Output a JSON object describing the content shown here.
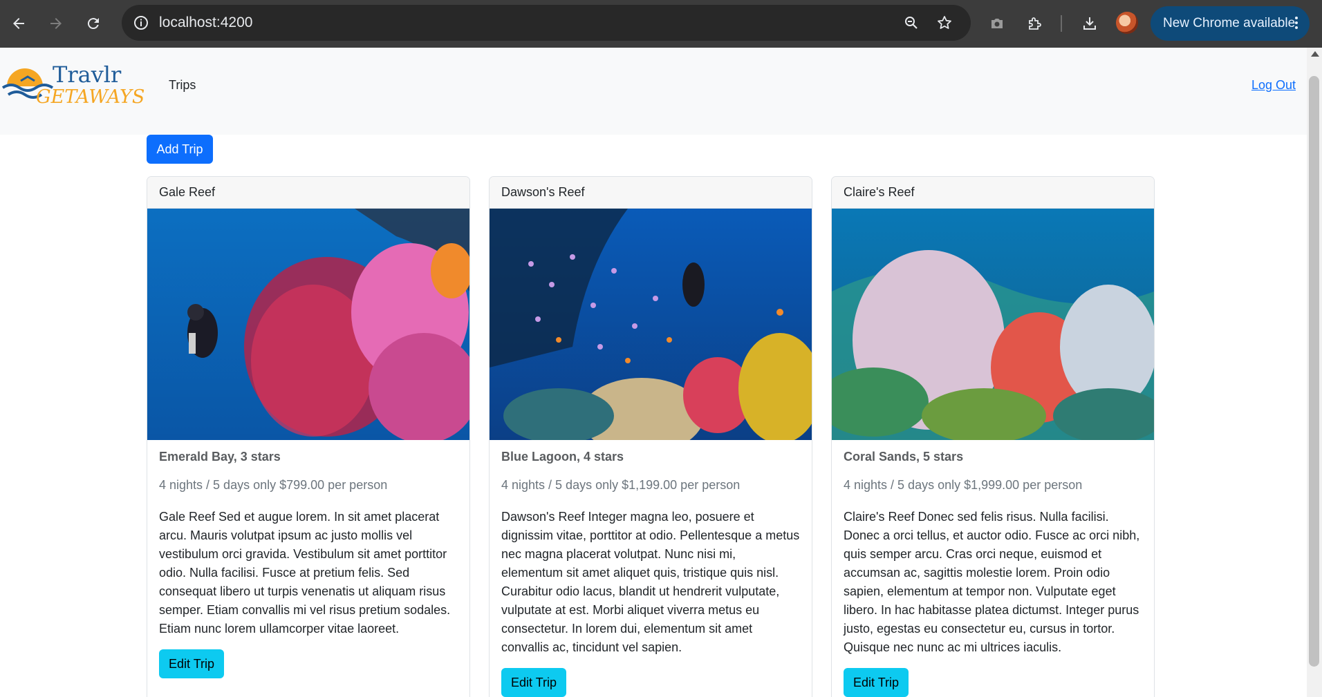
{
  "browser": {
    "url": "localhost:4200",
    "update_label": "New Chrome available",
    "icons": [
      "back-icon",
      "forward-icon",
      "reload-icon",
      "site-info-icon",
      "zoom-icon",
      "bookmark-star-icon",
      "screenshot-icon",
      "extensions-icon",
      "downloads-icon",
      "profile-avatar",
      "more-icon"
    ]
  },
  "navbar": {
    "logo_top": "Travlr",
    "logo_bottom": "GETAWAYS",
    "trips_link": "Trips",
    "logout_link": "Log Out"
  },
  "actions": {
    "add_trip": "Add Trip"
  },
  "trips": [
    {
      "name": "Gale Reef",
      "resort": "Emerald Bay, 3 stars",
      "price_line": "4 nights / 5 days only $799.00 per person",
      "description": "Gale Reef Sed et augue lorem. In sit amet placerat arcu. Mauris volutpat ipsum ac justo mollis vel vestibulum orci gravida. Vestibulum sit amet porttitor odio. Nulla facilisi. Fusce at pretium felis. Sed consequat libero ut turpis venenatis ut aliquam risus semper. Etiam convallis mi vel risus pretium sodales. Etiam nunc lorem ullamcorper vitae laoreet.",
      "edit_label": "Edit Trip"
    },
    {
      "name": "Dawson's Reef",
      "resort": "Blue Lagoon, 4 stars",
      "price_line": "4 nights / 5 days only $1,199.00 per person",
      "description": "Dawson's Reef Integer magna leo, posuere et dignissim vitae, porttitor at odio. Pellentesque a metus nec magna placerat volutpat. Nunc nisi mi, elementum sit amet aliquet quis, tristique quis nisl. Curabitur odio lacus, blandit ut hendrerit vulputate, vulputate at est. Morbi aliquet viverra metus eu consectetur. In lorem dui, elementum sit amet convallis ac, tincidunt vel sapien.",
      "edit_label": "Edit Trip"
    },
    {
      "name": "Claire's Reef",
      "resort": "Coral Sands, 5 stars",
      "price_line": "4 nights / 5 days only $1,999.00 per person",
      "description": "Claire's Reef Donec sed felis risus. Nulla facilisi. Donec a orci tellus, et auctor odio. Fusce ac orci nibh, quis semper arcu. Cras orci neque, euismod et accumsan ac, sagittis molestie lorem. Proin odio sapien, elementum at tempor non. Vulputate eget libero. In hac habitasse platea dictumst. Integer purus justo, egestas eu consectetur eu, cursus in tortor. Quisque nec nunc ac mi ultrices iaculis.",
      "edit_label": "Edit Trip"
    }
  ],
  "colors": {
    "primary": "#0d6efd",
    "info": "#0dcaf0",
    "navbar_bg": "#f8f9fa",
    "chrome_bg": "#3c3c3c",
    "update_pill": "#0e4a79"
  }
}
